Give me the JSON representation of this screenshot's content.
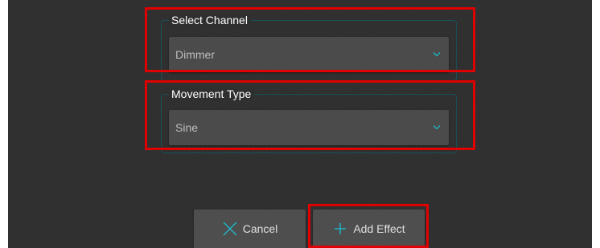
{
  "dialog": {
    "channel_group": {
      "label": "Select Channel",
      "value": "Dimmer"
    },
    "movement_group": {
      "label": "Movement Type",
      "value": "Sine"
    },
    "buttons": {
      "cancel_label": "Cancel",
      "add_label": "Add Effect"
    }
  },
  "icons": {
    "cancel": "close-icon",
    "add": "plus-icon",
    "dropdown": "chevron-down-icon"
  },
  "colors": {
    "panel_background": "#2f2f2f",
    "control_background": "#4a4a4a",
    "group_border": "#16525a",
    "accent": "#1fb6c8",
    "highlight": "#e00000",
    "label_text": "#ffffff",
    "value_text": "#bdbdbd"
  }
}
